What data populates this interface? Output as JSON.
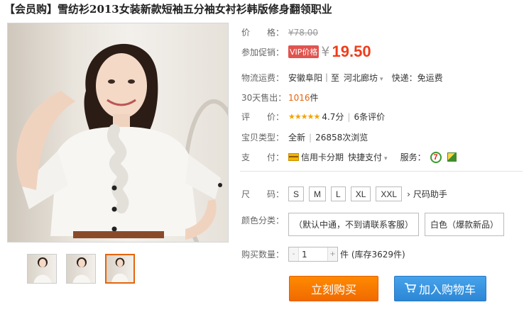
{
  "product": {
    "title": "【会员购】雪纺衫2013女装新款短袖五分袖女衬衫韩版修身翻领职业"
  },
  "price": {
    "label": "价　　格：",
    "original": "¥78.00",
    "promo_label": "参加促销：",
    "vip_badge": "VIP价格",
    "currency": "¥",
    "value": "19.50"
  },
  "shipping": {
    "label": "物流运费：",
    "route": "安徽阜阳｜至",
    "destination": "河北廊坊",
    "delivery": "快递：免运费"
  },
  "sales": {
    "label": "30天售出：",
    "count": "1016",
    "unit": "件"
  },
  "rating": {
    "label": "评　　价：",
    "stars": "★★★★★",
    "score": "4.7分",
    "reviews": "6条评价"
  },
  "item_type": {
    "label": "宝贝类型：",
    "condition": "全新",
    "views": "26858次浏览"
  },
  "payment": {
    "label": "支　　付：",
    "installment": "信用卡分期",
    "quick_pay": "快捷支付",
    "service_label": "服务："
  },
  "size": {
    "label": "尺　　码：",
    "options": [
      "S",
      "M",
      "L",
      "XL",
      "XXL"
    ],
    "guide": "尺码助手"
  },
  "color": {
    "label": "颜色分类：",
    "options": [
      "（默认中通，不到请联系客服）",
      "白色（爆款新品）"
    ]
  },
  "quantity": {
    "label": "购买数量：",
    "value": "1",
    "stock": "件 (库存3629件)"
  },
  "actions": {
    "buy_now": "立刻购买",
    "add_to_cart": "加入购物车"
  },
  "icons": {
    "cart": "cart-icon",
    "card": "credit-card-icon",
    "service_7day": "seven-day-return-icon",
    "service_guarantee": "guarantee-icon"
  }
}
